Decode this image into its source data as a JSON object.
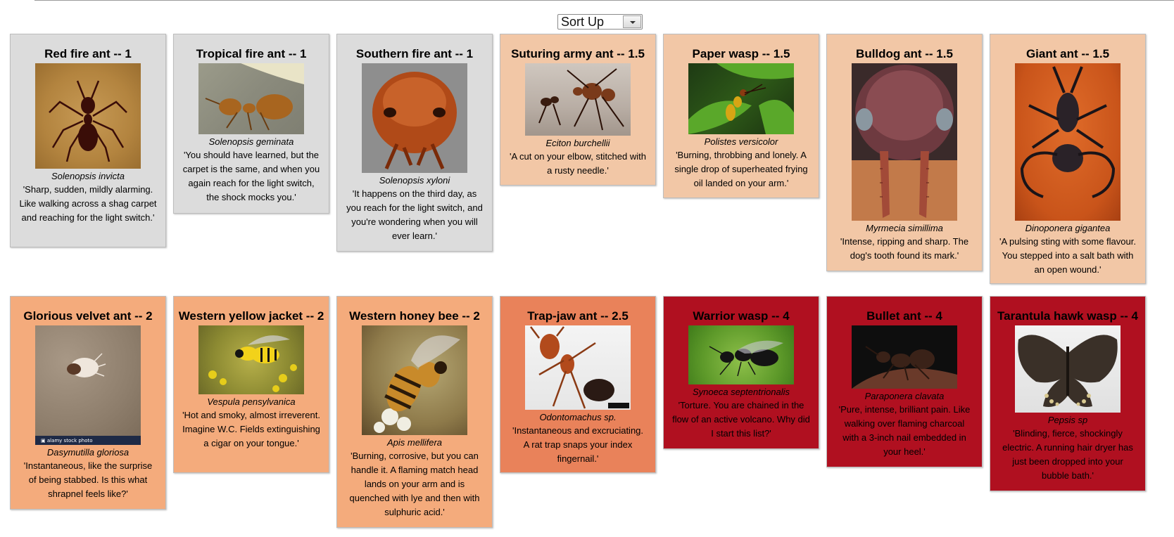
{
  "sort": {
    "selected": "Sort Up"
  },
  "cards": [
    {
      "title": "Red fire ant -- 1",
      "sci": "Solenopsis invicta",
      "desc": "'Sharp, sudden, mildly alarming. Like walking across a shag carpet and reaching for the light switch.'"
    },
    {
      "title": "Tropical fire ant -- 1",
      "sci": "Solenopsis geminata",
      "desc": "'You should have learned, but the carpet is the same, and when you again reach for the light switch, the shock mocks you.'"
    },
    {
      "title": "Southern fire ant -- 1",
      "sci": "Solenopsis xyloni",
      "desc": "'It happens on the third day, as you reach for the light switch, and you're wondering when you will ever learn.'"
    },
    {
      "title": "Suturing army ant -- 1.5",
      "sci": "Eciton burchellii",
      "desc": "'A cut on your elbow, stitched with a rusty needle.'"
    },
    {
      "title": "Paper wasp -- 1.5",
      "sci": "Polistes versicolor",
      "desc": "'Burning, throbbing and lonely. A single drop of superheated frying oil landed on your arm.'"
    },
    {
      "title": "Bulldog ant -- 1.5",
      "sci": "Myrmecia simillima",
      "desc": "'Intense, ripping and sharp. The dog's tooth found its mark.'"
    },
    {
      "title": "Giant ant -- 1.5",
      "sci": "Dinoponera gigantea",
      "desc": "'A pulsing sting with some flavour. You stepped into a salt bath with an open wound.'"
    },
    {
      "title": "Glorious velvet ant -- 2",
      "sci": "Dasymutilla gloriosa",
      "desc": "'Instantaneous, like the surprise of being stabbed. Is this what shrapnel feels like?'"
    },
    {
      "title": "Western yellow jacket -- 2",
      "sci": "Vespula pensylvanica",
      "desc": "'Hot and smoky, almost irreverent. Imagine W.C. Fields extinguishing a cigar on your tongue.'"
    },
    {
      "title": "Western honey bee -- 2",
      "sci": "Apis mellifera",
      "desc": "'Burning, corrosive, but you can handle it. A flaming match head lands on your arm and is quenched with lye and then with sulphuric acid.'"
    },
    {
      "title": "Trap-jaw ant -- 2.5",
      "sci": "Odontomachus sp.",
      "desc": "'Instantaneous and excruciating. A rat trap snaps your index fingernail.'"
    },
    {
      "title": "Warrior wasp -- 4",
      "sci": "Synoeca septentrionalis",
      "desc": "'Torture. You are chained in the flow of an active volcano. Why did I start this list?'"
    },
    {
      "title": "Bullet ant -- 4",
      "sci": "Paraponera clavata",
      "desc": "'Pure, intense, brilliant pain. Like walking over flaming charcoal with a 3-inch nail embedded in your heel.'"
    },
    {
      "title": "Tarantula hawk wasp -- 4",
      "sci": "Pepsis sp",
      "desc": "'Blinding, fierce, shockingly electric. A running hair dryer has just been dropped into your bubble bath.'"
    }
  ],
  "photo_watermarks": {
    "velvet": "alamy stock photo"
  },
  "colors": {
    "level1": "#dcdcdc",
    "level15": "#f2c7a6",
    "level2": "#f4ab7c",
    "level25": "#e9825a",
    "level4": "#b01020"
  }
}
